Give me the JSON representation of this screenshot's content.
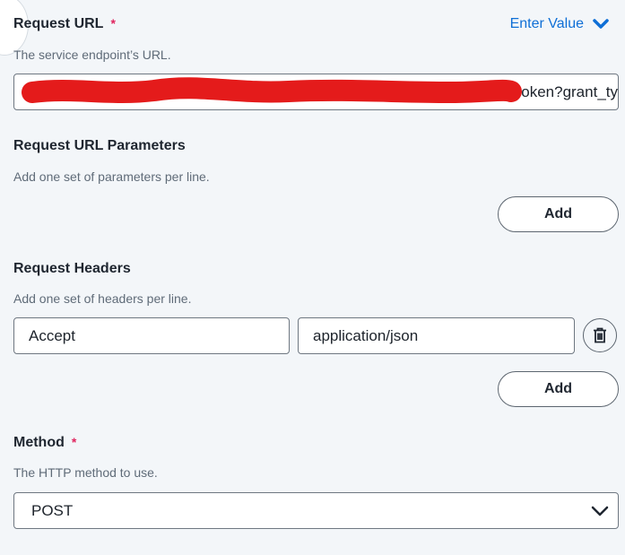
{
  "request_url": {
    "label": "Request URL",
    "required_mark": "*",
    "enter_value": "Enter Value",
    "help": "The service endpoint’s URL.",
    "value_visible": "oken?grant_ty"
  },
  "url_params": {
    "label": "Request URL Parameters",
    "help": "Add one set of parameters per line.",
    "add_label": "Add"
  },
  "headers": {
    "label": "Request Headers",
    "help": "Add one set of headers per line.",
    "rows": [
      {
        "key": "Accept",
        "value": "application/json"
      }
    ],
    "add_label": "Add"
  },
  "method": {
    "label": "Method",
    "required_mark": "*",
    "help": "The HTTP method to use.",
    "selected": "POST"
  },
  "colors": {
    "accent": "#0f6fd6",
    "required": "#e0245e",
    "redaction": "#e41b1b"
  }
}
